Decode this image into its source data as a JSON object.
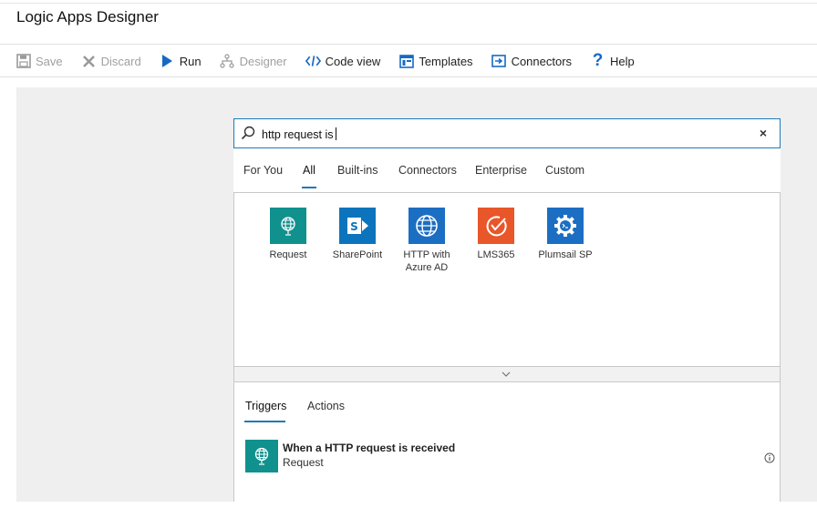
{
  "app": {
    "title": "Logic Apps Designer"
  },
  "toolbar": {
    "save": "Save",
    "discard": "Discard",
    "run": "Run",
    "designer": "Designer",
    "code_view": "Code view",
    "templates": "Templates",
    "connectors": "Connectors",
    "help": "Help"
  },
  "search": {
    "value": "http request is"
  },
  "tabs": [
    "For You",
    "All",
    "Built-ins",
    "Connectors",
    "Enterprise",
    "Custom"
  ],
  "active_tab": "All",
  "connectors": [
    {
      "label": "Request",
      "icon": "globe-icon",
      "color": "#10918e"
    },
    {
      "label": "SharePoint",
      "icon": "sharepoint-icon",
      "color": "#0b74bd"
    },
    {
      "label": "HTTP with Azure AD",
      "icon": "globe-icon",
      "color": "#1b6ec2"
    },
    {
      "label": "LMS365",
      "icon": "check-circle-icon",
      "color": "#e8562a"
    },
    {
      "label": "Plumsail SP",
      "icon": "gear-icon",
      "color": "#1b6ec2"
    }
  ],
  "subtabs": [
    "Triggers",
    "Actions"
  ],
  "active_subtab": "Triggers",
  "trigger": {
    "name": "When a HTTP request is received",
    "connector": "Request",
    "icon": "globe-icon",
    "color": "#10918e"
  },
  "colors": {
    "accent": "#1e7bb6",
    "canvas": "#efefef"
  }
}
